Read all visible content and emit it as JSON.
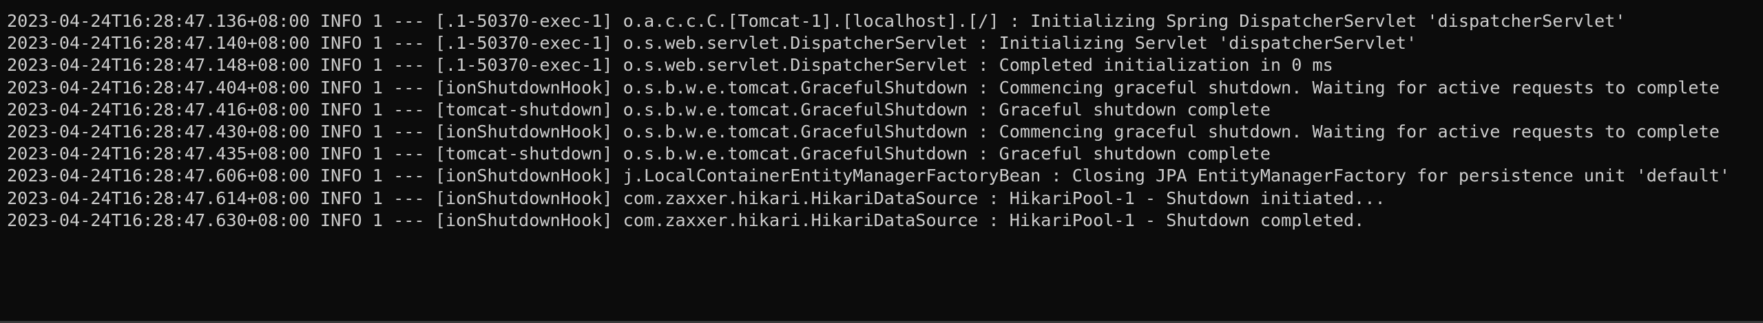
{
  "terminal": {
    "lines": [
      "2023-04-24T16:28:47.136+08:00 INFO 1 --- [.1-50370-exec-1] o.a.c.c.C.[Tomcat-1].[localhost].[/] : Initializing Spring DispatcherServlet 'dispatcherServlet'",
      "2023-04-24T16:28:47.140+08:00 INFO 1 --- [.1-50370-exec-1] o.s.web.servlet.DispatcherServlet : Initializing Servlet 'dispatcherServlet'",
      "2023-04-24T16:28:47.148+08:00 INFO 1 --- [.1-50370-exec-1] o.s.web.servlet.DispatcherServlet : Completed initialization in 0 ms",
      "2023-04-24T16:28:47.404+08:00 INFO 1 --- [ionShutdownHook] o.s.b.w.e.tomcat.GracefulShutdown : Commencing graceful shutdown. Waiting for active requests to complete",
      "2023-04-24T16:28:47.416+08:00 INFO 1 --- [tomcat-shutdown] o.s.b.w.e.tomcat.GracefulShutdown : Graceful shutdown complete",
      "2023-04-24T16:28:47.430+08:00 INFO 1 --- [ionShutdownHook] o.s.b.w.e.tomcat.GracefulShutdown : Commencing graceful shutdown. Waiting for active requests to complete",
      "2023-04-24T16:28:47.435+08:00 INFO 1 --- [tomcat-shutdown] o.s.b.w.e.tomcat.GracefulShutdown : Graceful shutdown complete",
      "2023-04-24T16:28:47.606+08:00 INFO 1 --- [ionShutdownHook] j.LocalContainerEntityManagerFactoryBean : Closing JPA EntityManagerFactory for persistence unit 'default'",
      "2023-04-24T16:28:47.614+08:00 INFO 1 --- [ionShutdownHook] com.zaxxer.hikari.HikariDataSource : HikariPool-1 - Shutdown initiated...",
      "2023-04-24T16:28:47.630+08:00 INFO 1 --- [ionShutdownHook] com.zaxxer.hikari.HikariDataSource : HikariPool-1 - Shutdown completed."
    ]
  },
  "colors": {
    "background": "#0c0c0c",
    "text": "#cccccc"
  }
}
